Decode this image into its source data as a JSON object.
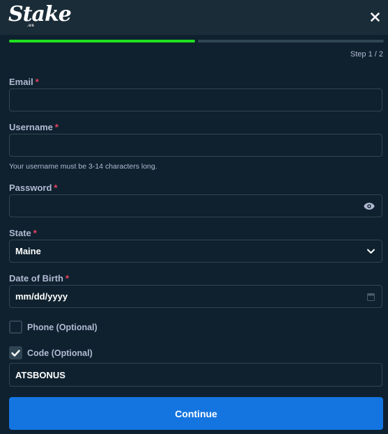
{
  "brand": {
    "logo_text": "Stake",
    "logo_sub": ".us"
  },
  "progress": {
    "current_step": 1,
    "total_steps": 2,
    "fraction_complete": 0.5,
    "step_text": "Step 1 / 2"
  },
  "form": {
    "required_marker": "*",
    "email": {
      "label": "Email",
      "value": ""
    },
    "username": {
      "label": "Username",
      "value": "",
      "hint": "Your username must be 3-14 characters long."
    },
    "password": {
      "label": "Password",
      "value": ""
    },
    "state": {
      "label": "State",
      "value": "Maine"
    },
    "dob": {
      "label": "Date of Birth",
      "value": "mm/dd/yyyy"
    },
    "phone": {
      "label": "Phone (Optional)",
      "checked": false
    },
    "code": {
      "label": "Code (Optional)",
      "checked": true,
      "value": "ATSBONUS"
    }
  },
  "continue_label": "Continue",
  "colors": {
    "accent": "#1475e1",
    "progress": "#1fe01f",
    "required": "#ed4163",
    "background": "#0f212e",
    "header": "#1a2c38"
  },
  "icons": {
    "close": "close-icon",
    "eye": "eye-icon",
    "chevron": "chevron-down-icon",
    "calendar": "calendar-icon",
    "check": "check-icon"
  }
}
